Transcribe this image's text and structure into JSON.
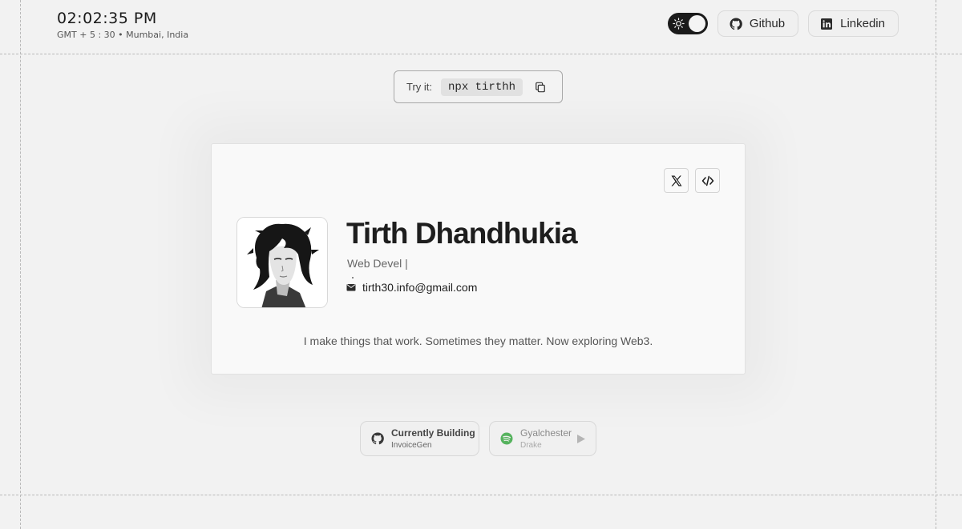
{
  "header": {
    "time": "02:02:35 PM",
    "timezone": "GMT + 5 : 30 • Mumbai, India",
    "github_label": "Github",
    "linkedin_label": "Linkedin",
    "theme_toggle_icon": "sun-icon"
  },
  "try_it": {
    "label": "Try it:",
    "command": "npx tirthh",
    "copy_icon": "copy-icon"
  },
  "profile": {
    "name": "Tirth Dhandhukia",
    "role": "Web Devel |",
    "email": "tirth30.info@gmail.com",
    "tagline": "I make things that work. Sometimes they matter. Now exploring Web3.",
    "avatar_alt": "avatar",
    "actions": [
      "x-logo-icon",
      "code-icon"
    ]
  },
  "status": {
    "building_title": "Currently Building",
    "building_project": "InvoiceGen",
    "music_title": "Gyalchester",
    "music_artist": "Drake",
    "spotify_color": "#56b35e"
  },
  "colors": {
    "background": "#f2f2f2",
    "card": "#f9f9f9",
    "toggle": "#1b1b1b"
  }
}
